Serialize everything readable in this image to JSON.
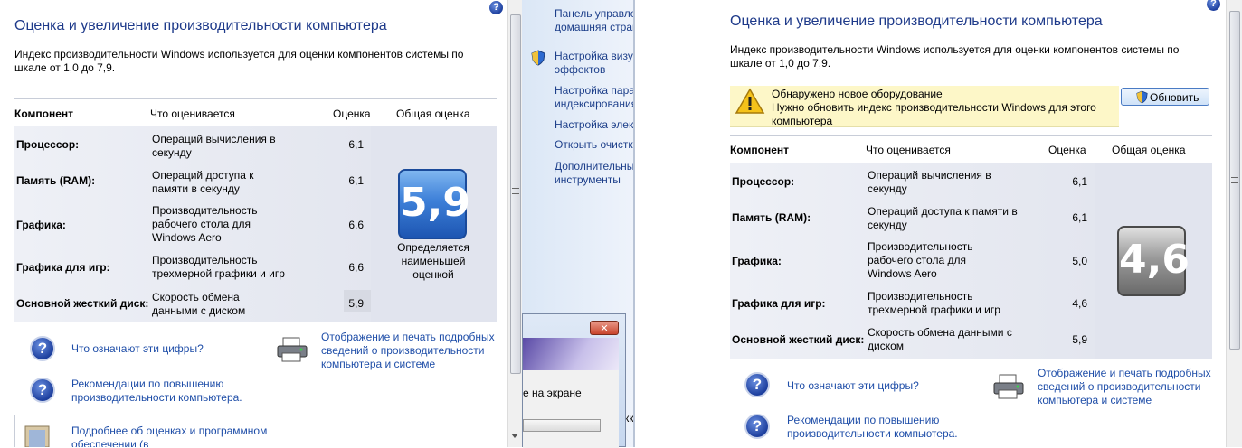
{
  "left": {
    "title": "Оценка и увеличение производительности компьютера",
    "description": "Индекс производительности Windows используется для оценки компонентов системы по шкале от 1,0 до 7,9.",
    "headers": {
      "component": "Компонент",
      "rated": "Что оценивается",
      "score": "Оценка",
      "overall": "Общая оценка"
    },
    "rows": [
      {
        "name": "Процессор:",
        "desc": "Операций вычисления в секунду",
        "score": "6,1"
      },
      {
        "name": "Память (RAM):",
        "desc": "Операций доступа к памяти в секунду",
        "score": "6,1"
      },
      {
        "name": "Графика:",
        "desc": "Производительность рабочего стола для Windows Aero",
        "score": "6,6"
      },
      {
        "name": "Графика для игр:",
        "desc": "Производительность трехмерной графики и игр",
        "score": "6,6"
      },
      {
        "name": "Основной жесткий диск:",
        "desc": "Скорость обмена данными с диском",
        "score": "5,9"
      }
    ],
    "base_score": "5,9",
    "base_caption": "Определяется наименьшей оценкой",
    "links": {
      "what_numbers": "Что означают эти цифры?",
      "tips": "Рекомендации по повышению производительности компьютера.",
      "print": "Отображение и печать подробных сведений о производительности компьютера и системе",
      "more": "Подробнее об оценках и программном обеспечении (в"
    }
  },
  "nav": {
    "items": [
      "Панель управления - домашняя страница",
      "Настройка визуальных эффектов",
      "Настройка параметров индексирования",
      "Настройка электропитания",
      "Открыть очистку диска",
      "Дополнительные инструменты"
    ]
  },
  "popup": {
    "text": "е на экране",
    "behind_text": "кки"
  },
  "right": {
    "title": "Оценка и увеличение производительности компьютера",
    "description": "Индекс производительности Windows используется для оценки компонентов системы по шкале от 1,0 до 7,9.",
    "warning_title": "Обнаружено новое оборудование",
    "warning_text": "Нужно обновить индекс производительности Windows для этого компьютера",
    "update_button": "Обновить",
    "headers": {
      "component": "Компонент",
      "rated": "Что оценивается",
      "score": "Оценка",
      "overall": "Общая оценка"
    },
    "rows": [
      {
        "name": "Процессор:",
        "desc": "Операций вычисления в секунду",
        "score": "6,1"
      },
      {
        "name": "Память (RAM):",
        "desc": "Операций доступа к памяти в секунду",
        "score": "6,1"
      },
      {
        "name": "Графика:",
        "desc": "Производительность рабочего стола для Windows Aero",
        "score": "5,0"
      },
      {
        "name": "Графика для игр:",
        "desc": "Производительность трехмерной графики и игр",
        "score": "4,6"
      },
      {
        "name": "Основной жесткий диск:",
        "desc": "Скорость обмена данными с диском",
        "score": "5,9"
      }
    ],
    "base_score": "4,6",
    "links": {
      "what_numbers": "Что означают эти цифры?",
      "tips": "Рекомендации по повышению производительности компьютера.",
      "print": "Отображение и печать подробных сведений о производительности компьютера и системе"
    }
  },
  "icons": {
    "help": "help-question-icon",
    "printer": "printer-icon",
    "shield": "uac-shield-icon",
    "warning": "warning-triangle-icon",
    "close": "close-icon"
  },
  "colors": {
    "title": "#1e3a8a",
    "link": "#1f4ea8",
    "badge_blue": "#2f6fd0",
    "badge_gray": "#8a8a8a",
    "warning_bg": "#fdf7c8"
  }
}
